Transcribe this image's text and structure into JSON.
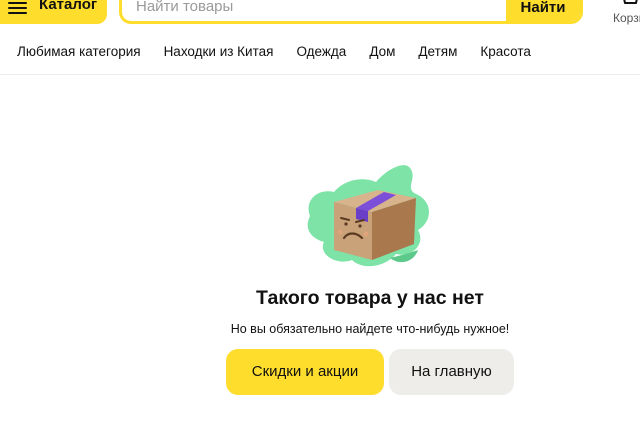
{
  "header": {
    "catalog_label": "Каталог",
    "search_placeholder": "Найти товары",
    "search_button_label": "Найти",
    "cart_label": "Корзина",
    "accent_color": "#ffdd2d"
  },
  "categories": [
    "Любимая категория",
    "Находки из Китая",
    "Одежда",
    "Дом",
    "Детям",
    "Красота"
  ],
  "empty_state": {
    "title": "Такого товара у нас нет",
    "subtitle": "Но вы обязательно найдете что-нибудь нужное!",
    "primary_button": "Скидки и акции",
    "secondary_button": "На главную",
    "illustration": "sad-box-illustration"
  }
}
